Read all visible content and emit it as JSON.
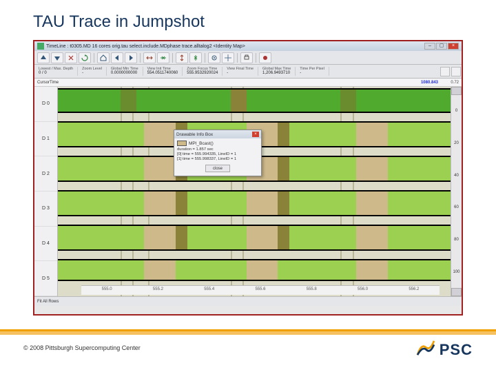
{
  "slide": {
    "title": "TAU Trace in Jumpshot",
    "copyright": "© 2008 Pittsburgh Supercomputing Center",
    "logo_text": "PSC"
  },
  "window": {
    "title": "TimeLine : t0305.MD 16 cores orig.tau select.include.MDphase trace.alltalog2 <Identity Map>",
    "toolbar_icons": [
      "arrow-up",
      "arrow-down",
      "scissors",
      "refresh",
      "sep",
      "home",
      "back",
      "forward",
      "sep",
      "zoom-out-h",
      "zoom-in-h",
      "sep",
      "zoom-out-v",
      "zoom-in-v",
      "sep",
      "target",
      "crosshair",
      "sep",
      "print",
      "sep",
      "marker"
    ],
    "info": [
      {
        "lbl": "Lowest / Max. Depth",
        "val": "0 / 0"
      },
      {
        "lbl": "Zoom Level",
        "val": "-"
      },
      {
        "lbl": "Global Min Time",
        "val": "0.0000000000"
      },
      {
        "lbl": "View Init Time",
        "val": "554.0511740060"
      },
      {
        "lbl": "Zoom Focus Time",
        "val": "555.9532920024"
      },
      {
        "lbl": "View Final Time",
        "val": "-"
      },
      {
        "lbl": "Global Max Time",
        "val": "1,206.9493710"
      },
      {
        "lbl": "Time Per Pixel",
        "val": "-"
      }
    ],
    "cursor_label": "CursorTime",
    "cursor_value": "1080.843",
    "ylabels": [
      "D 0",
      "D 1",
      "D 2",
      "D 3",
      "D 4",
      "D 5"
    ],
    "rscroll": [
      "0",
      "20",
      "40",
      "60",
      "80",
      "100"
    ],
    "xticks": [
      "555.0",
      "555.2",
      "555.4",
      "555.6",
      "555.8",
      "556.0",
      "556.2"
    ],
    "status": {
      "fit": "Fit All Rows",
      "right": "0.72"
    }
  },
  "popup": {
    "title": "Drawable Info Box",
    "category": "MPI_Bcast()",
    "lines": [
      "duration = 1.857 sec",
      "[0] time = 555.994335, LineID = 1",
      "[1] time = 555.998337, LineID = 1"
    ],
    "close": "close"
  }
}
